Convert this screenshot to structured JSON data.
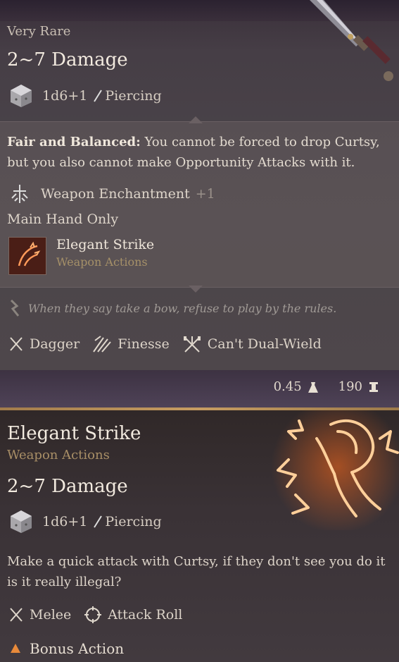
{
  "item": {
    "rarity": "Very Rare",
    "damage": "2~7 Damage",
    "dice": "1d6+1",
    "damage_type": "Piercing",
    "passive_name": "Fair and Balanced:",
    "passive_text": " You cannot be forced to drop Curtsy, but you also cannot make Opportunity Attacks with it.",
    "enchant_label": "Weapon Enchantment",
    "enchant_bonus": "+1",
    "main_hand": "Main Hand Only",
    "action_name": "Elegant Strike",
    "action_category": "Weapon Actions",
    "flavor": "When they say take a bow, refuse to play by the rules.",
    "properties": [
      "Dagger",
      "Finesse",
      "Can't Dual-Wield"
    ],
    "weight": "0.45",
    "value": "190"
  },
  "action": {
    "title": "Elegant Strike",
    "category": "Weapon Actions",
    "damage": "2~7 Damage",
    "dice": "1d6+1",
    "damage_type": "Piercing",
    "description": "Make a quick attack with Curtsy, if they don't see you do it is it really illegal?",
    "tags": [
      "Melee",
      "Attack Roll"
    ],
    "cost": "Bonus Action"
  },
  "colors": {
    "accent_gold": "#c79d62",
    "action_category": "#a88e66",
    "glow": "#ff7a2a"
  },
  "icons": [
    "d6-dice-icon",
    "piercing-icon",
    "enchantment-icon",
    "elegant-strike-icon",
    "flavor-icon",
    "dagger-icon",
    "finesse-icon",
    "cant-dual-wield-icon",
    "weight-icon",
    "gold-icon",
    "melee-icon",
    "attack-roll-icon",
    "bonus-action-icon",
    "dagger-artwork"
  ]
}
